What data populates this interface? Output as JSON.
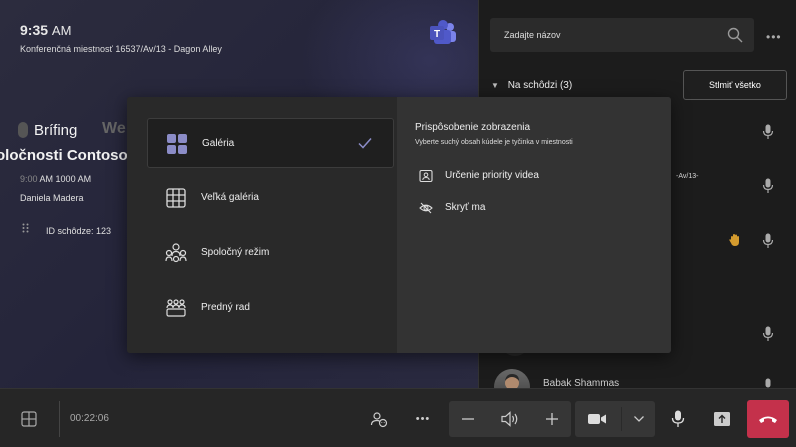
{
  "room": {
    "time": "9:35",
    "ampm": "AM",
    "name": "Konferenčná miestnosť 16537/Av/13 - Dagon Alley"
  },
  "meeting": {
    "title_line1": "Brífing",
    "title_ghost": "We",
    "title_line2": "oločnosti Contoso",
    "time_start": "9:00",
    "time_range": "AM 1000 AM",
    "organizer": "Daniela Madera",
    "id_label": "ID schôdze: 123"
  },
  "roster": {
    "search_placeholder": "Zadajte názov",
    "section_label": "Na schôdzi (3)",
    "mute_all_label": "Stlmiť všetko",
    "snippet": "-Av/13-",
    "person_name": "Babak Shammas"
  },
  "dialog": {
    "layouts": [
      {
        "label": "Galéria",
        "icon": "gallery-icon",
        "selected": true
      },
      {
        "label": "Veľká galéria",
        "icon": "large-gallery-icon",
        "selected": false
      },
      {
        "label": "Spoločný režim",
        "icon": "together-mode-icon",
        "selected": false
      },
      {
        "label": "Predný rad",
        "icon": "front-row-icon",
        "selected": false
      }
    ],
    "customize_title": "Prispôsobenie zobrazenia",
    "customize_subtitle": "Vyberte suchý obsah kúdele je tyčinka v miestnosti",
    "items": [
      {
        "label": "Určenie priority videa",
        "icon": "video-priority-icon"
      },
      {
        "label": "Skryť ma",
        "icon": "eye-off-icon"
      }
    ]
  },
  "bottombar": {
    "timer": "00:22:06"
  },
  "colors": {
    "accent": "#8b8cc7",
    "hangup": "#c4314b",
    "raise_hand": "#d49b2e"
  }
}
